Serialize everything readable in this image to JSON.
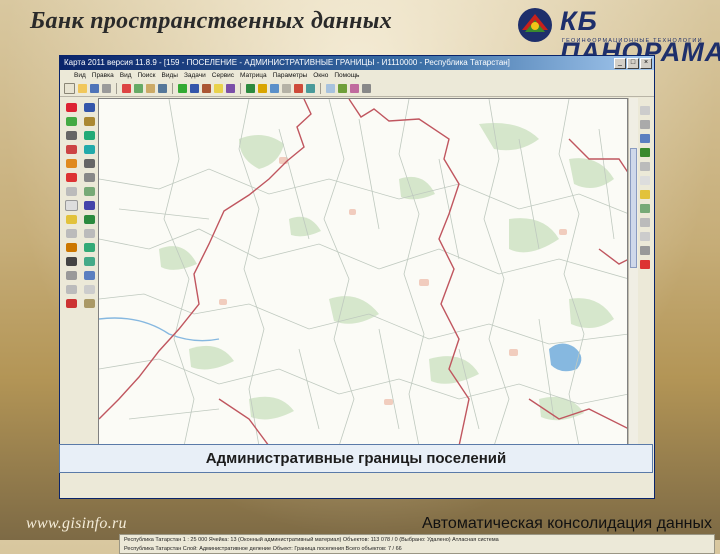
{
  "slide": {
    "title": "Банк пространственных данных",
    "site": "www.gisinfo.ru",
    "subtitle": "Автоматическая консолидация данных",
    "caption": "Административные границы поселений"
  },
  "logo": {
    "name": "КБ ПАНОРАМА",
    "tagline": "ГЕОИНФОРМАЦИОННЫЕ ТЕХНОЛОГИИ",
    "colors": {
      "navy": "#1e2f6b",
      "red": "#c8211b",
      "green": "#3a8a2e",
      "yellow": "#f2c418"
    }
  },
  "window": {
    "title": "Карта 2011 версия 11.8.9 - [159 - ПОСЕЛЕНИЕ - АДМИНИСТРАТИВНЫЕ ГРАНИЦЫ - И1110000 - Республика Татарстан]",
    "controls": [
      "_",
      "□",
      "×"
    ]
  },
  "menu": [
    "Вид",
    "Правка",
    "Вид",
    "Поиск",
    "Виды",
    "Задачи",
    "Сервис",
    "Матрица",
    "Параметры",
    "Окно",
    "Помощь"
  ],
  "status": {
    "line1": "Республика Татарстан  1 : 25 000   Ячейка: 13 (Оконный административный материал)  Объектов: 113 078 / 0 (Выбрано: Удалено)    Атласная система",
    "line2": "Республика Татарстан   Слой: Административное деление   Объект: Граница поселения   Всего объектов: 7 / 66"
  },
  "colors": {
    "boundary_red": "#c0565f",
    "boundary_green": "#bfc9bf",
    "green_zone": "#cfe3c4",
    "water": "#86b8e0",
    "settlement": "#f0c8b8"
  },
  "icons": [
    "pencil-icon",
    "brush-icon",
    "select-icon",
    "hand-icon",
    "zoom-icon",
    "ruler-icon",
    "layer-icon",
    "print-icon",
    "search-icon"
  ]
}
